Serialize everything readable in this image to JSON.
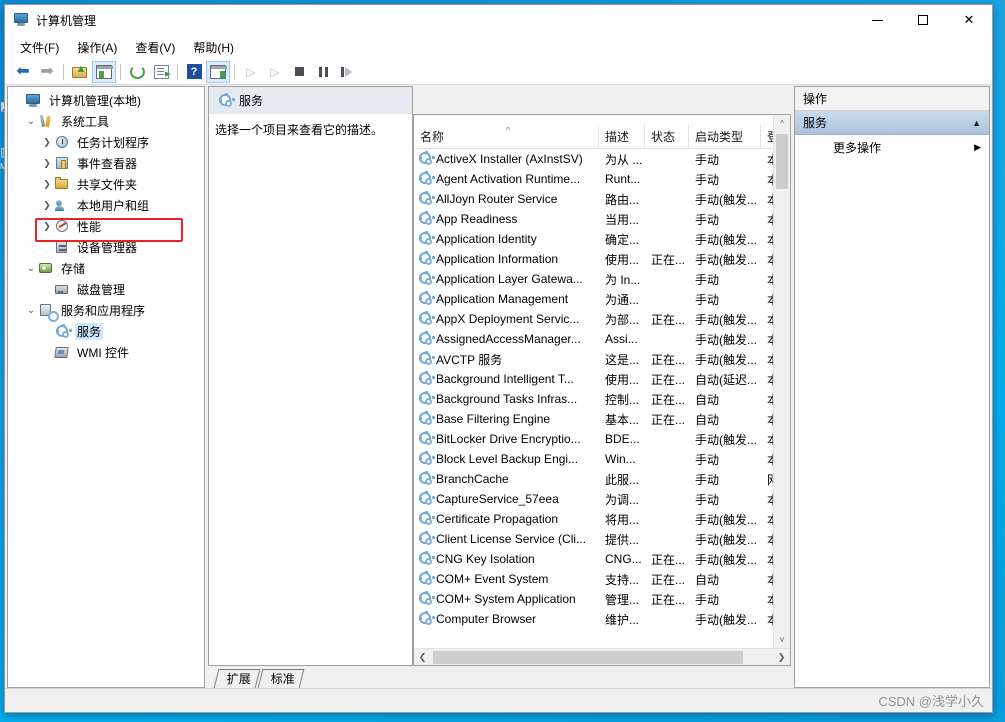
{
  "window": {
    "title": "计算机管理",
    "title_icon": "computer-management-icon",
    "controls": {
      "minimize": "—",
      "maximize": "▢",
      "close": "✕"
    }
  },
  "menubar": [
    {
      "label": "文件(F)",
      "name": "menu-file"
    },
    {
      "label": "操作(A)",
      "name": "menu-action"
    },
    {
      "label": "查看(V)",
      "name": "menu-view"
    },
    {
      "label": "帮助(H)",
      "name": "menu-help"
    }
  ],
  "toolbar": [
    {
      "name": "back-button",
      "icon": "back-arrow-icon",
      "glyph": "⬅",
      "pressed": false
    },
    {
      "name": "forward-button",
      "icon": "forward-arrow-icon",
      "glyph": "➡",
      "pressed": false
    },
    {
      "name": "up-one-level-button",
      "icon": "up-folder-icon",
      "glyph": "",
      "pressed": false
    },
    {
      "name": "show-hide-tree-button",
      "icon": "console-tree-icon",
      "glyph": "",
      "pressed": true
    },
    {
      "name": "refresh-button",
      "icon": "refresh-icon",
      "glyph": "",
      "pressed": false
    },
    {
      "name": "export-list-button",
      "icon": "export-list-icon",
      "glyph": "",
      "pressed": false
    },
    {
      "name": "help-button",
      "icon": "help-icon",
      "glyph": "?",
      "pressed": false
    },
    {
      "name": "show-action-pane-button",
      "icon": "action-pane-icon",
      "glyph": "",
      "pressed": true
    },
    {
      "name": "start-service-button",
      "icon": "play-icon",
      "glyph": "▷",
      "pressed": false
    },
    {
      "name": "resume-service-button",
      "icon": "play-icon",
      "glyph": "▷",
      "pressed": false
    },
    {
      "name": "stop-service-button",
      "icon": "stop-icon",
      "glyph": "",
      "pressed": false
    },
    {
      "name": "pause-service-button",
      "icon": "pause-icon",
      "glyph": "",
      "pressed": false
    },
    {
      "name": "restart-service-button",
      "icon": "restart-icon",
      "glyph": "",
      "pressed": false
    }
  ],
  "tree": {
    "root": {
      "label": "计算机管理(本地)",
      "icon": "computer-icon",
      "expander": "",
      "indent": 0
    },
    "nodes": [
      {
        "label": "计算机管理(本地)",
        "icon": "computer-icon",
        "expander": "",
        "indent": 0,
        "selected": false
      },
      {
        "label": "系统工具",
        "icon": "tools-icon",
        "expander": "v",
        "indent": 1,
        "selected": false
      },
      {
        "label": "任务计划程序",
        "icon": "clock-icon",
        "expander": ">",
        "indent": 2,
        "selected": false
      },
      {
        "label": "事件查看器",
        "icon": "event-viewer-icon",
        "expander": ">",
        "indent": 2,
        "selected": false
      },
      {
        "label": "共享文件夹",
        "icon": "shared-folder-icon",
        "expander": ">",
        "indent": 2,
        "selected": false
      },
      {
        "label": "本地用户和组",
        "icon": "users-groups-icon",
        "expander": ">",
        "indent": 2,
        "selected": false
      },
      {
        "label": "性能",
        "icon": "performance-icon",
        "expander": ">",
        "indent": 2,
        "selected": false
      },
      {
        "label": "设备管理器",
        "icon": "device-manager-icon",
        "expander": "",
        "indent": 2,
        "selected": false
      },
      {
        "label": "存储",
        "icon": "storage-icon",
        "expander": "v",
        "indent": 1,
        "selected": false
      },
      {
        "label": "磁盘管理",
        "icon": "disk-management-icon",
        "expander": "",
        "indent": 2,
        "selected": false
      },
      {
        "label": "服务和应用程序",
        "icon": "services-apps-icon",
        "expander": "v",
        "indent": 1,
        "selected": false
      },
      {
        "label": "服务",
        "icon": "service-gear-icon",
        "expander": "",
        "indent": 2,
        "selected": true
      },
      {
        "label": "WMI 控件",
        "icon": "wmi-control-icon",
        "expander": "",
        "indent": 2,
        "selected": false
      }
    ],
    "annotation_color": "#ee2222"
  },
  "content": {
    "header": {
      "label": "服务",
      "icon": "service-gear-icon"
    },
    "description_panel": {
      "text": "选择一个项目来查看它的描述。"
    },
    "columns": [
      {
        "key": "name",
        "label": "名称",
        "sorted": true,
        "sort_caret": "^"
      },
      {
        "key": "desc",
        "label": "描述",
        "sorted": false,
        "sort_caret": ""
      },
      {
        "key": "state",
        "label": "状态",
        "sorted": false,
        "sort_caret": ""
      },
      {
        "key": "start",
        "label": "启动类型",
        "sorted": false,
        "sort_caret": ""
      },
      {
        "key": "logon",
        "label": "登",
        "sorted": false,
        "sort_caret": ""
      }
    ],
    "rows": [
      {
        "name": "ActiveX Installer (AxInstSV)",
        "desc": "为从 ...",
        "state": "",
        "start": "手动",
        "logon": "本"
      },
      {
        "name": "Agent Activation Runtime...",
        "desc": "Runt...",
        "state": "",
        "start": "手动",
        "logon": "本"
      },
      {
        "name": "AllJoyn Router Service",
        "desc": "路由...",
        "state": "",
        "start": "手动(触发...",
        "logon": "本"
      },
      {
        "name": "App Readiness",
        "desc": "当用...",
        "state": "",
        "start": "手动",
        "logon": "本"
      },
      {
        "name": "Application Identity",
        "desc": "确定...",
        "state": "",
        "start": "手动(触发...",
        "logon": "本"
      },
      {
        "name": "Application Information",
        "desc": "使用...",
        "state": "正在...",
        "start": "手动(触发...",
        "logon": "本"
      },
      {
        "name": "Application Layer Gatewa...",
        "desc": "为 In...",
        "state": "",
        "start": "手动",
        "logon": "本"
      },
      {
        "name": "Application Management",
        "desc": "为通...",
        "state": "",
        "start": "手动",
        "logon": "本"
      },
      {
        "name": "AppX Deployment Servic...",
        "desc": "为部...",
        "state": "正在...",
        "start": "手动(触发...",
        "logon": "本"
      },
      {
        "name": "AssignedAccessManager...",
        "desc": "Assi...",
        "state": "",
        "start": "手动(触发...",
        "logon": "本"
      },
      {
        "name": "AVCTP 服务",
        "desc": "这是...",
        "state": "正在...",
        "start": "手动(触发...",
        "logon": "本"
      },
      {
        "name": "Background Intelligent T...",
        "desc": "使用...",
        "state": "正在...",
        "start": "自动(延迟...",
        "logon": "本"
      },
      {
        "name": "Background Tasks Infras...",
        "desc": "控制...",
        "state": "正在...",
        "start": "自动",
        "logon": "本"
      },
      {
        "name": "Base Filtering Engine",
        "desc": "基本...",
        "state": "正在...",
        "start": "自动",
        "logon": "本"
      },
      {
        "name": "BitLocker Drive Encryptio...",
        "desc": "BDE...",
        "state": "",
        "start": "手动(触发...",
        "logon": "本"
      },
      {
        "name": "Block Level Backup Engi...",
        "desc": "Win...",
        "state": "",
        "start": "手动",
        "logon": "本"
      },
      {
        "name": "BranchCache",
        "desc": "此服...",
        "state": "",
        "start": "手动",
        "logon": "网"
      },
      {
        "name": "CaptureService_57eea",
        "desc": "为调...",
        "state": "",
        "start": "手动",
        "logon": "本"
      },
      {
        "name": "Certificate Propagation",
        "desc": "将用...",
        "state": "",
        "start": "手动(触发...",
        "logon": "本"
      },
      {
        "name": "Client License Service (Cli...",
        "desc": "提供...",
        "state": "",
        "start": "手动(触发...",
        "logon": "本"
      },
      {
        "name": "CNG Key Isolation",
        "desc": "CNG...",
        "state": "正在...",
        "start": "手动(触发...",
        "logon": "本"
      },
      {
        "name": "COM+ Event System",
        "desc": "支持...",
        "state": "正在...",
        "start": "自动",
        "logon": "本"
      },
      {
        "name": "COM+ System Application",
        "desc": "管理...",
        "state": "正在...",
        "start": "手动",
        "logon": "本"
      },
      {
        "name": "Computer Browser",
        "desc": "维护...",
        "state": "",
        "start": "手动(触发...",
        "logon": "本"
      }
    ],
    "scrollbars": {
      "vertical": {
        "up": "^",
        "down": "v"
      },
      "horizontal": {
        "left": "❮",
        "right": "❯"
      }
    },
    "tabs": [
      {
        "label": "扩展",
        "name": "tab-extended",
        "active": false
      },
      {
        "label": "标准",
        "name": "tab-standard",
        "active": true
      }
    ]
  },
  "actions_pane": {
    "title": "操作",
    "group": {
      "label": "服务",
      "caret": "▲"
    },
    "items": [
      {
        "label": "更多操作",
        "name": "action-more-actions",
        "caret": "▶"
      }
    ]
  },
  "statusbar": {
    "left_text": "",
    "watermark": "CSDN @浅学小久"
  },
  "desktop": {
    "icons": [
      {
        "label": "",
        "glyph": "▣"
      },
      {
        "label": "M",
        "glyph": "◧"
      }
    ]
  }
}
